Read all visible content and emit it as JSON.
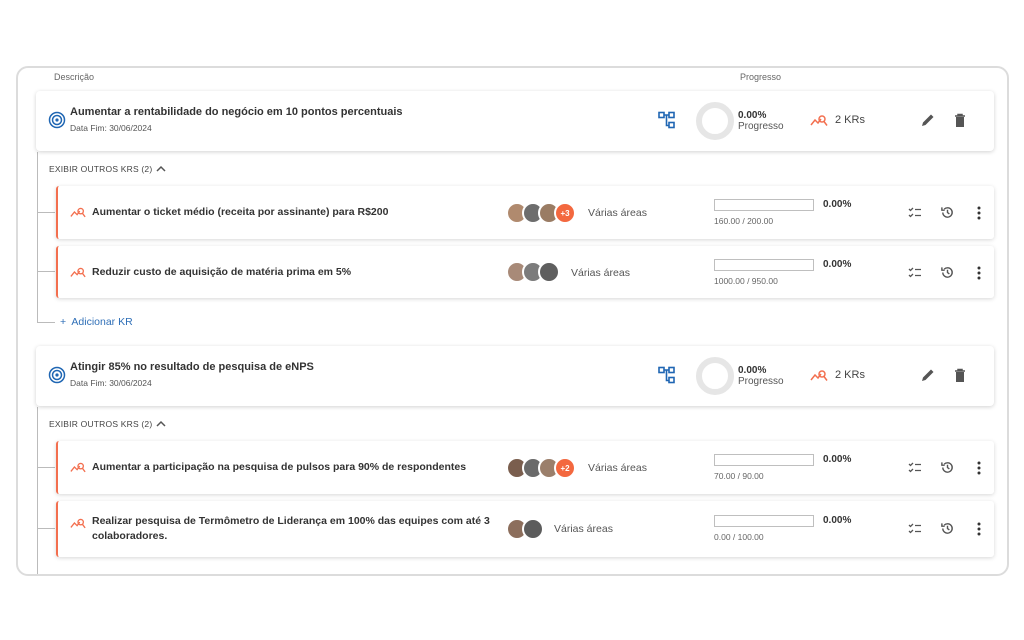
{
  "headers": {
    "description": "Descrição",
    "progress": "Progresso"
  },
  "colors": {
    "accent": "#f36f4f",
    "blue": "#1f66b3",
    "more_badge": "#f3683f"
  },
  "objectives": [
    {
      "title": "Aumentar a rentabilidade do negócio em 10 pontos percentuais",
      "date": "Data Fim: 30/06/2024",
      "progress_pct": "0.00%",
      "progress_label": "Progresso",
      "kr_count": "2 KRs",
      "toggle_label": "EXIBIR OUTROS KRS (2)",
      "add_kr_label": "Adicionar KR",
      "krs": [
        {
          "title": "Aumentar o ticket médio (receita por assinante) para R$200",
          "more": "+3",
          "areas": "Várias áreas",
          "pct": "0.00%",
          "values": "160.00 / 200.00",
          "progress": 0
        },
        {
          "title": "Reduzir custo de aquisição de matéria prima em 5%",
          "more": "",
          "areas": "Várias áreas",
          "pct": "0.00%",
          "values": "1000.00 / 950.00",
          "progress": 0
        }
      ]
    },
    {
      "title": "Atingir 85% no resultado de pesquisa de eNPS",
      "date": "Data Fim: 30/06/2024",
      "progress_pct": "0.00%",
      "progress_label": "Progresso",
      "kr_count": "2 KRs",
      "toggle_label": "EXIBIR OUTROS KRS (2)",
      "krs": [
        {
          "title": "Aumentar a participação na pesquisa de pulsos para 90% de respondentes",
          "more": "+2",
          "areas": "Várias áreas",
          "pct": "0.00%",
          "values": "70.00 / 90.00",
          "progress": 0
        },
        {
          "title": "Realizar pesquisa de Termômetro de Liderança em 100% das equipes com até 3 colaboradores.",
          "more": "",
          "areas": "Várias áreas",
          "pct": "0.00%",
          "values": "0.00 / 100.00",
          "progress": 0
        }
      ]
    }
  ]
}
